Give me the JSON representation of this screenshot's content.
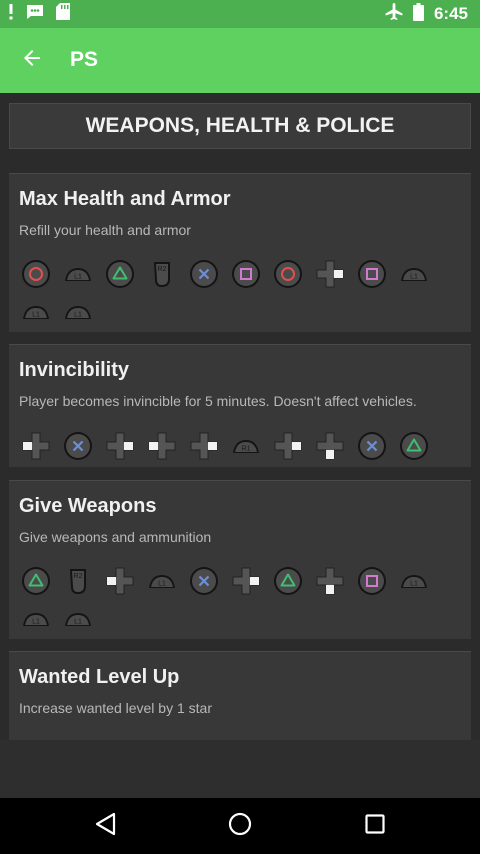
{
  "status_bar": {
    "time": "6:45",
    "icons": [
      "alert-icon",
      "chat-icon",
      "sd-card-icon",
      "airplane-mode-icon",
      "battery-icon"
    ]
  },
  "app_bar": {
    "title": "PS",
    "back_icon": "arrow-left-icon"
  },
  "category": {
    "title": "WEAPONS, HEALTH & POLICE"
  },
  "cheats": [
    {
      "title": "Max Health and Armor",
      "description": "Refill your health and armor",
      "rows": [
        [
          "circle",
          "L1",
          "triangle",
          "R2",
          "cross",
          "square",
          "circle",
          "dpad-right",
          "square",
          "L1"
        ],
        [
          "L1",
          "L1"
        ]
      ]
    },
    {
      "title": "Invincibility",
      "description": "Player becomes invincible for 5 minutes. Doesn't affect vehicles.",
      "rows": [
        [
          "dpad-left",
          "cross",
          "dpad-right",
          "dpad-left",
          "dpad-right",
          "R1",
          "dpad-right",
          "dpad-down",
          "cross",
          "triangle"
        ]
      ]
    },
    {
      "title": "Give Weapons",
      "description": "Give weapons and ammunition",
      "rows": [
        [
          "triangle",
          "R2",
          "dpad-left",
          "L1",
          "cross",
          "dpad-right",
          "triangle",
          "dpad-down",
          "square",
          "L1"
        ],
        [
          "L1",
          "L1"
        ]
      ]
    },
    {
      "title": "Wanted Level Up",
      "description": "Increase wanted level by 1 star",
      "rows": []
    }
  ],
  "colors": {
    "status_bar": "#4caf50",
    "app_bar": "#5fd160",
    "circle": "#e05050",
    "triangle": "#3fbf6f",
    "cross": "#6d8fd6",
    "square": "#d07ad0"
  },
  "nav": {
    "back_icon": "nav-back-icon",
    "home_icon": "nav-home-icon",
    "recents_icon": "nav-recents-icon"
  }
}
